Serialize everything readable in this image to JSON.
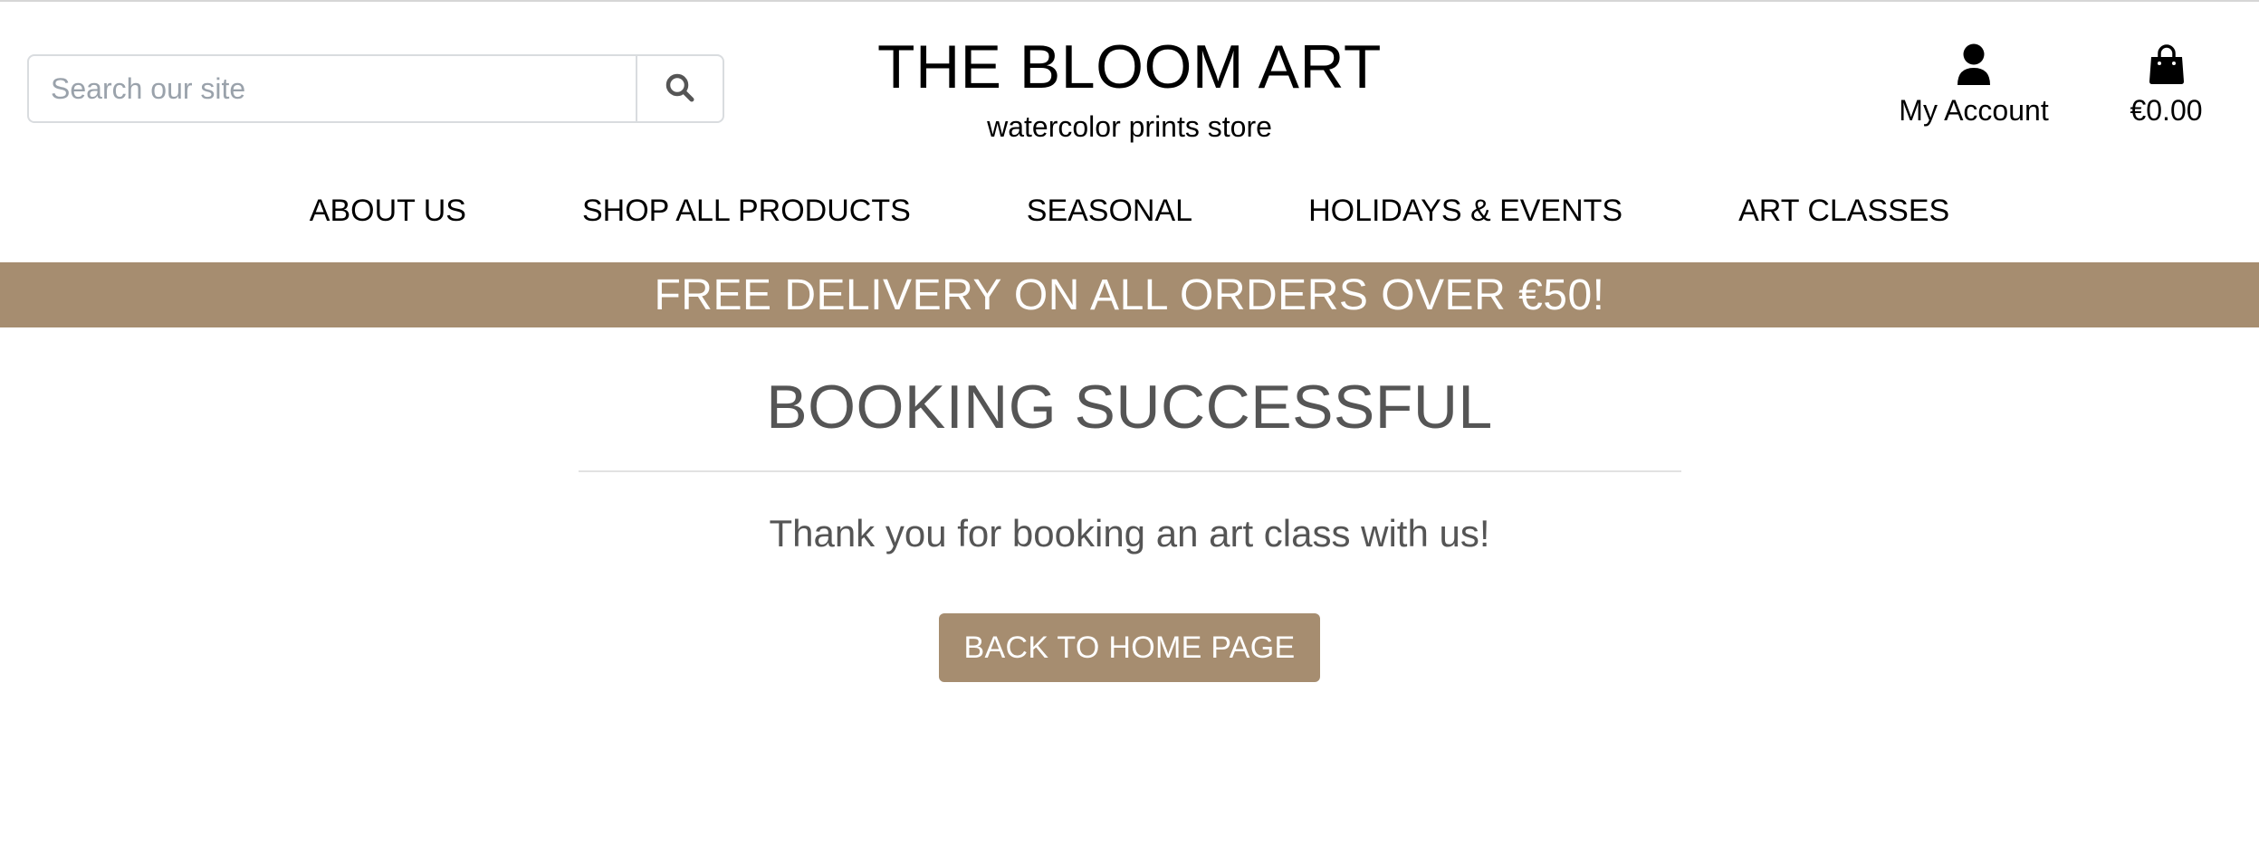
{
  "search": {
    "placeholder": "Search our site",
    "icon": "search-icon"
  },
  "brand": {
    "title": "THE BLOOM ART",
    "subtitle": "watercolor prints store"
  },
  "account": {
    "label": "My Account",
    "icon": "user-icon"
  },
  "bag": {
    "total": "€0.00",
    "icon": "shopping-bag-icon"
  },
  "nav": {
    "items": [
      {
        "label": "ABOUT US"
      },
      {
        "label": "SHOP ALL PRODUCTS"
      },
      {
        "label": "SEASONAL"
      },
      {
        "label": "HOLIDAYS & EVENTS"
      },
      {
        "label": "ART CLASSES"
      }
    ]
  },
  "banner": {
    "text": "FREE DELIVERY ON ALL ORDERS OVER €50!"
  },
  "main": {
    "heading": "BOOKING SUCCESSFUL",
    "message": "Thank you for booking an art class with us!",
    "button_label": "BACK TO HOME PAGE"
  },
  "colors": {
    "accent": "#a68d70",
    "heading_text": "#555555"
  }
}
